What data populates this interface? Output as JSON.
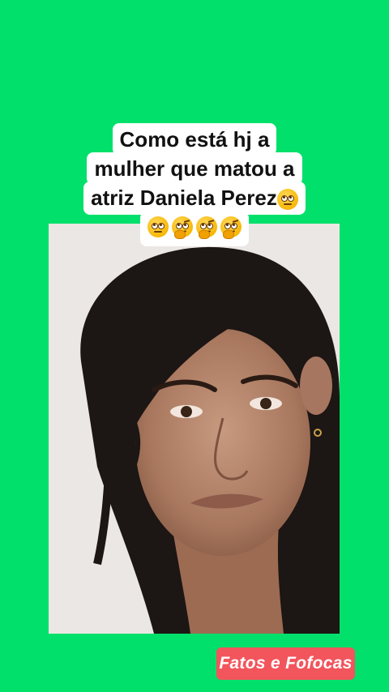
{
  "caption": {
    "lines": [
      "Como está hj a",
      "mulher que matou a",
      "atriz Daniela Perez"
    ],
    "emoji_inline": "rolling-eyes-emoji",
    "emoji_row": [
      "rolling-eyes-emoji",
      "thinking-face-emoji",
      "thinking-face-emoji",
      "thinking-face-emoji"
    ]
  },
  "photo": {
    "subject": "portrait-photo"
  },
  "watermark": {
    "label": "Fatos e Fofocas"
  },
  "colors": {
    "background": "#00e06a",
    "badge": "#f2555c",
    "caption_bg": "#ffffff"
  }
}
